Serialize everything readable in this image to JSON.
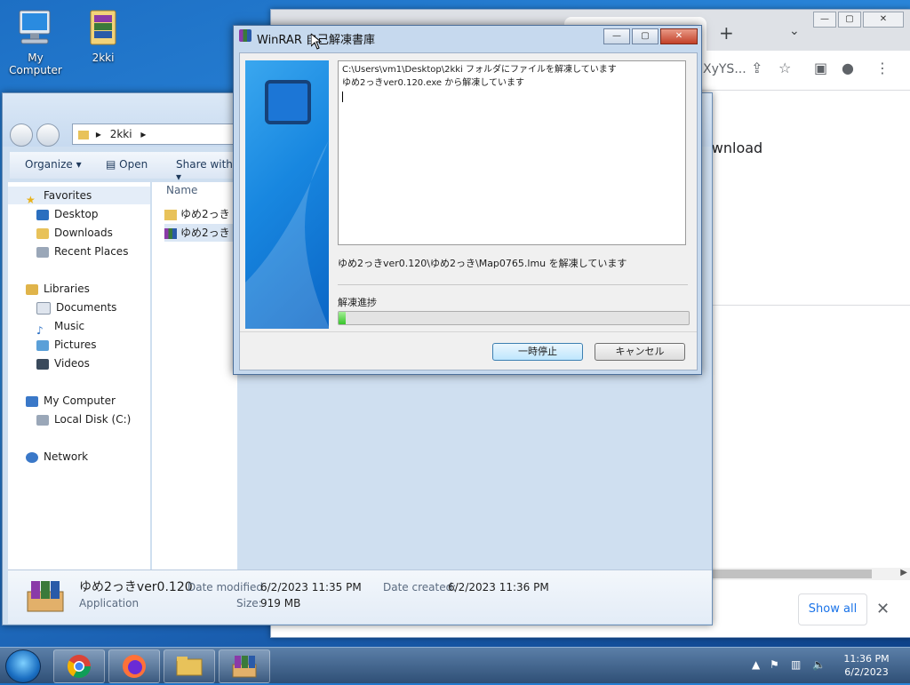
{
  "desktop": {
    "icons": [
      {
        "label": "My Computer",
        "icon": "computer-icon"
      },
      {
        "label": "2kki",
        "icon": "archive-icon"
      }
    ]
  },
  "chrome": {
    "url_fragment": "XyYS...",
    "content_text": "ownload",
    "show_all_label": "Show all",
    "tab_icons": [
      "plus-icon",
      "chevron-down-icon"
    ],
    "toolbar_icons": [
      "share-icon",
      "star-icon",
      "sidebar-icon",
      "profile-icon",
      "menu-icon"
    ]
  },
  "explorer": {
    "breadcrumb": "2kki",
    "commands": {
      "organize": "Organize",
      "open": "Open",
      "share_with": "Share with"
    },
    "nav": {
      "favorites": "Favorites",
      "favorites_items": [
        "Desktop",
        "Downloads",
        "Recent Places"
      ],
      "libraries": "Libraries",
      "libraries_items": [
        "Documents",
        "Music",
        "Pictures",
        "Videos"
      ],
      "computer": "My Computer",
      "computer_items": [
        "Local Disk (C:)"
      ],
      "network": "Network"
    },
    "column_header": "Name",
    "files": [
      {
        "name": "ゆめ2っき",
        "type": "folder"
      },
      {
        "name": "ゆめ2っき",
        "type": "archive",
        "selected": true
      }
    ],
    "details": {
      "name": "ゆめ2っきver0.120",
      "type": "Application",
      "date_modified_label": "Date modified:",
      "date_modified": "6/2/2023 11:35 PM",
      "date_created_label": "Date created:",
      "date_created": "6/2/2023 11:36 PM",
      "size_label": "Size:",
      "size": "919 MB"
    }
  },
  "winrar": {
    "title": "WinRAR 自己解凍書庫",
    "log_lines": [
      "C:\\Users\\vm1\\Desktop\\2kki フォルダにファイルを解凍しています",
      "ゆめ2っきver0.120.exe から解凍しています"
    ],
    "current_file": "ゆめ2っきver0.120\\ゆめ2っき\\Map0765.lmu を解凍しています",
    "progress_label": "解凍進捗",
    "progress": 0.02,
    "pause_label": "一時停止",
    "cancel_label": "キャンセル"
  },
  "taskbar": {
    "apps": [
      "chrome",
      "firefox",
      "explorer",
      "winrar"
    ],
    "tray_icons": [
      "show-hidden-icons",
      "action-center-flag-icon",
      "network-icon",
      "volume-muted-icon"
    ],
    "time": "11:36 PM",
    "date": "6/2/2023"
  },
  "colors": {
    "desktop_bg": "#1d6fc4",
    "progress_fill": "#37c42a",
    "banner": "#1887e0"
  }
}
